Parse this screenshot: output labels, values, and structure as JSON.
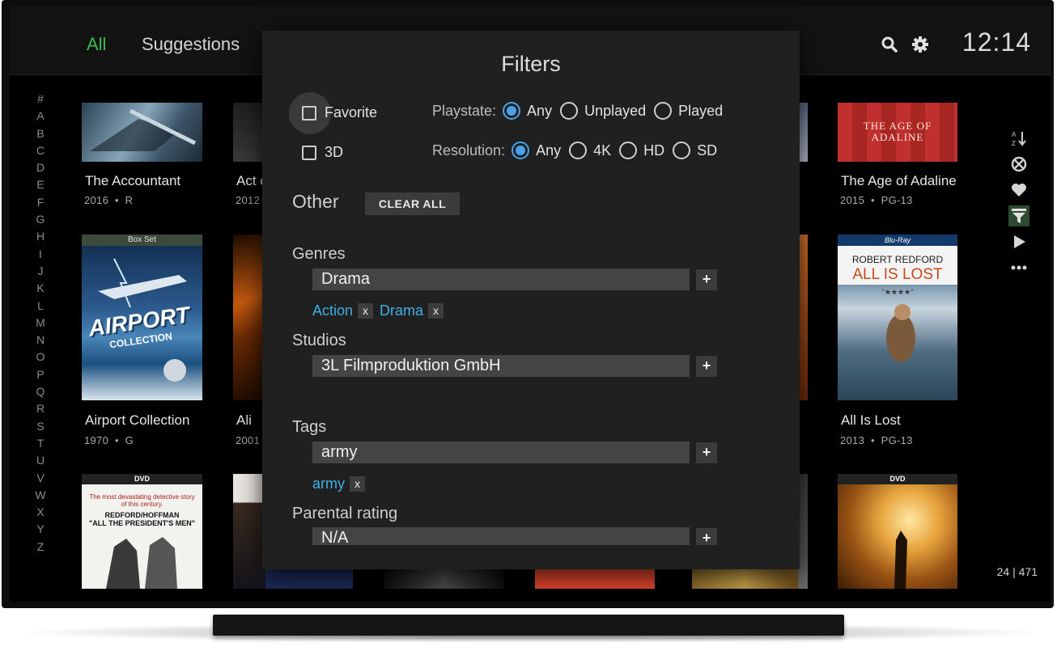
{
  "header": {
    "tabs": [
      {
        "label": "All",
        "active": true
      },
      {
        "label": "Suggestions",
        "active": false
      }
    ],
    "icons": [
      "search-icon",
      "gear-icon"
    ],
    "clock": "12:14"
  },
  "alphabet": [
    "#",
    "A",
    "B",
    "C",
    "D",
    "E",
    "F",
    "G",
    "H",
    "I",
    "J",
    "K",
    "L",
    "M",
    "N",
    "O",
    "P",
    "Q",
    "R",
    "S",
    "T",
    "U",
    "V",
    "W",
    "X",
    "Y",
    "Z"
  ],
  "library": {
    "items": [
      {
        "title": "The Accountant",
        "year": "2016",
        "rating": "R"
      },
      {
        "title": "Act of Valor",
        "year": "2012"
      },
      {
        "title": "The Age of Adaline",
        "year": "2015",
        "rating": "PG-13"
      },
      {
        "title": "Airport Collection",
        "year": "1970",
        "rating": "G"
      },
      {
        "title": "Ali",
        "year": "2001"
      },
      {
        "title": "All Is Lost",
        "year": "2013",
        "rating": "PG-13"
      }
    ],
    "poster_text": {
      "age_of_adaline_art": "THE AGE OF ADALINE",
      "airport_box": "Box Set",
      "airport_title": "AIRPORT",
      "airport_sub": "COLLECTION",
      "all_is_lost_bluray": "Blu-Ray",
      "all_is_lost_actor": "ROBERT REDFORD",
      "all_is_lost_title": "ALL IS LOST",
      "all_is_lost_stars": "\"★★★★\"",
      "dvd": "DVD",
      "presidents_tag": "The most devastating detective story of this century.",
      "presidents_names": "REDFORD/HOFFMAN",
      "presidents_title": "\"ALL THE PRESIDENT'S MEN\""
    },
    "sep": "•",
    "counter": "24 | 471"
  },
  "sidebar": {
    "icons": [
      "sort-az-icon",
      "no-sign-icon",
      "heart-icon",
      "filter-icon",
      "play-icon",
      "more-icon"
    ],
    "active": "filter-icon"
  },
  "filters": {
    "title": "Filters",
    "favorite_label": "Favorite",
    "threed_label": "3D",
    "playstate": {
      "label": "Playstate:",
      "options": [
        "Any",
        "Unplayed",
        "Played"
      ],
      "selected": "Any"
    },
    "resolution": {
      "label": "Resolution:",
      "options": [
        "Any",
        "4K",
        "HD",
        "SD"
      ],
      "selected": "Any"
    },
    "other_label": "Other",
    "clear_all": "CLEAR ALL",
    "genres": {
      "label": "Genres",
      "value": "Drama",
      "chips": [
        "Action",
        "Drama"
      ]
    },
    "studios": {
      "label": "Studios",
      "value": "3L Filmproduktion GmbH"
    },
    "tags": {
      "label": "Tags",
      "value": "army",
      "chips": [
        "army"
      ]
    },
    "parental": {
      "label": "Parental rating",
      "value": "N/A"
    },
    "plus": "+",
    "remove": "x"
  },
  "colors": {
    "accent_green": "#3dbb4e",
    "accent_blue": "#4aa3ea",
    "chip_blue": "#3fb0e6",
    "dialog_bg": "#202020"
  }
}
